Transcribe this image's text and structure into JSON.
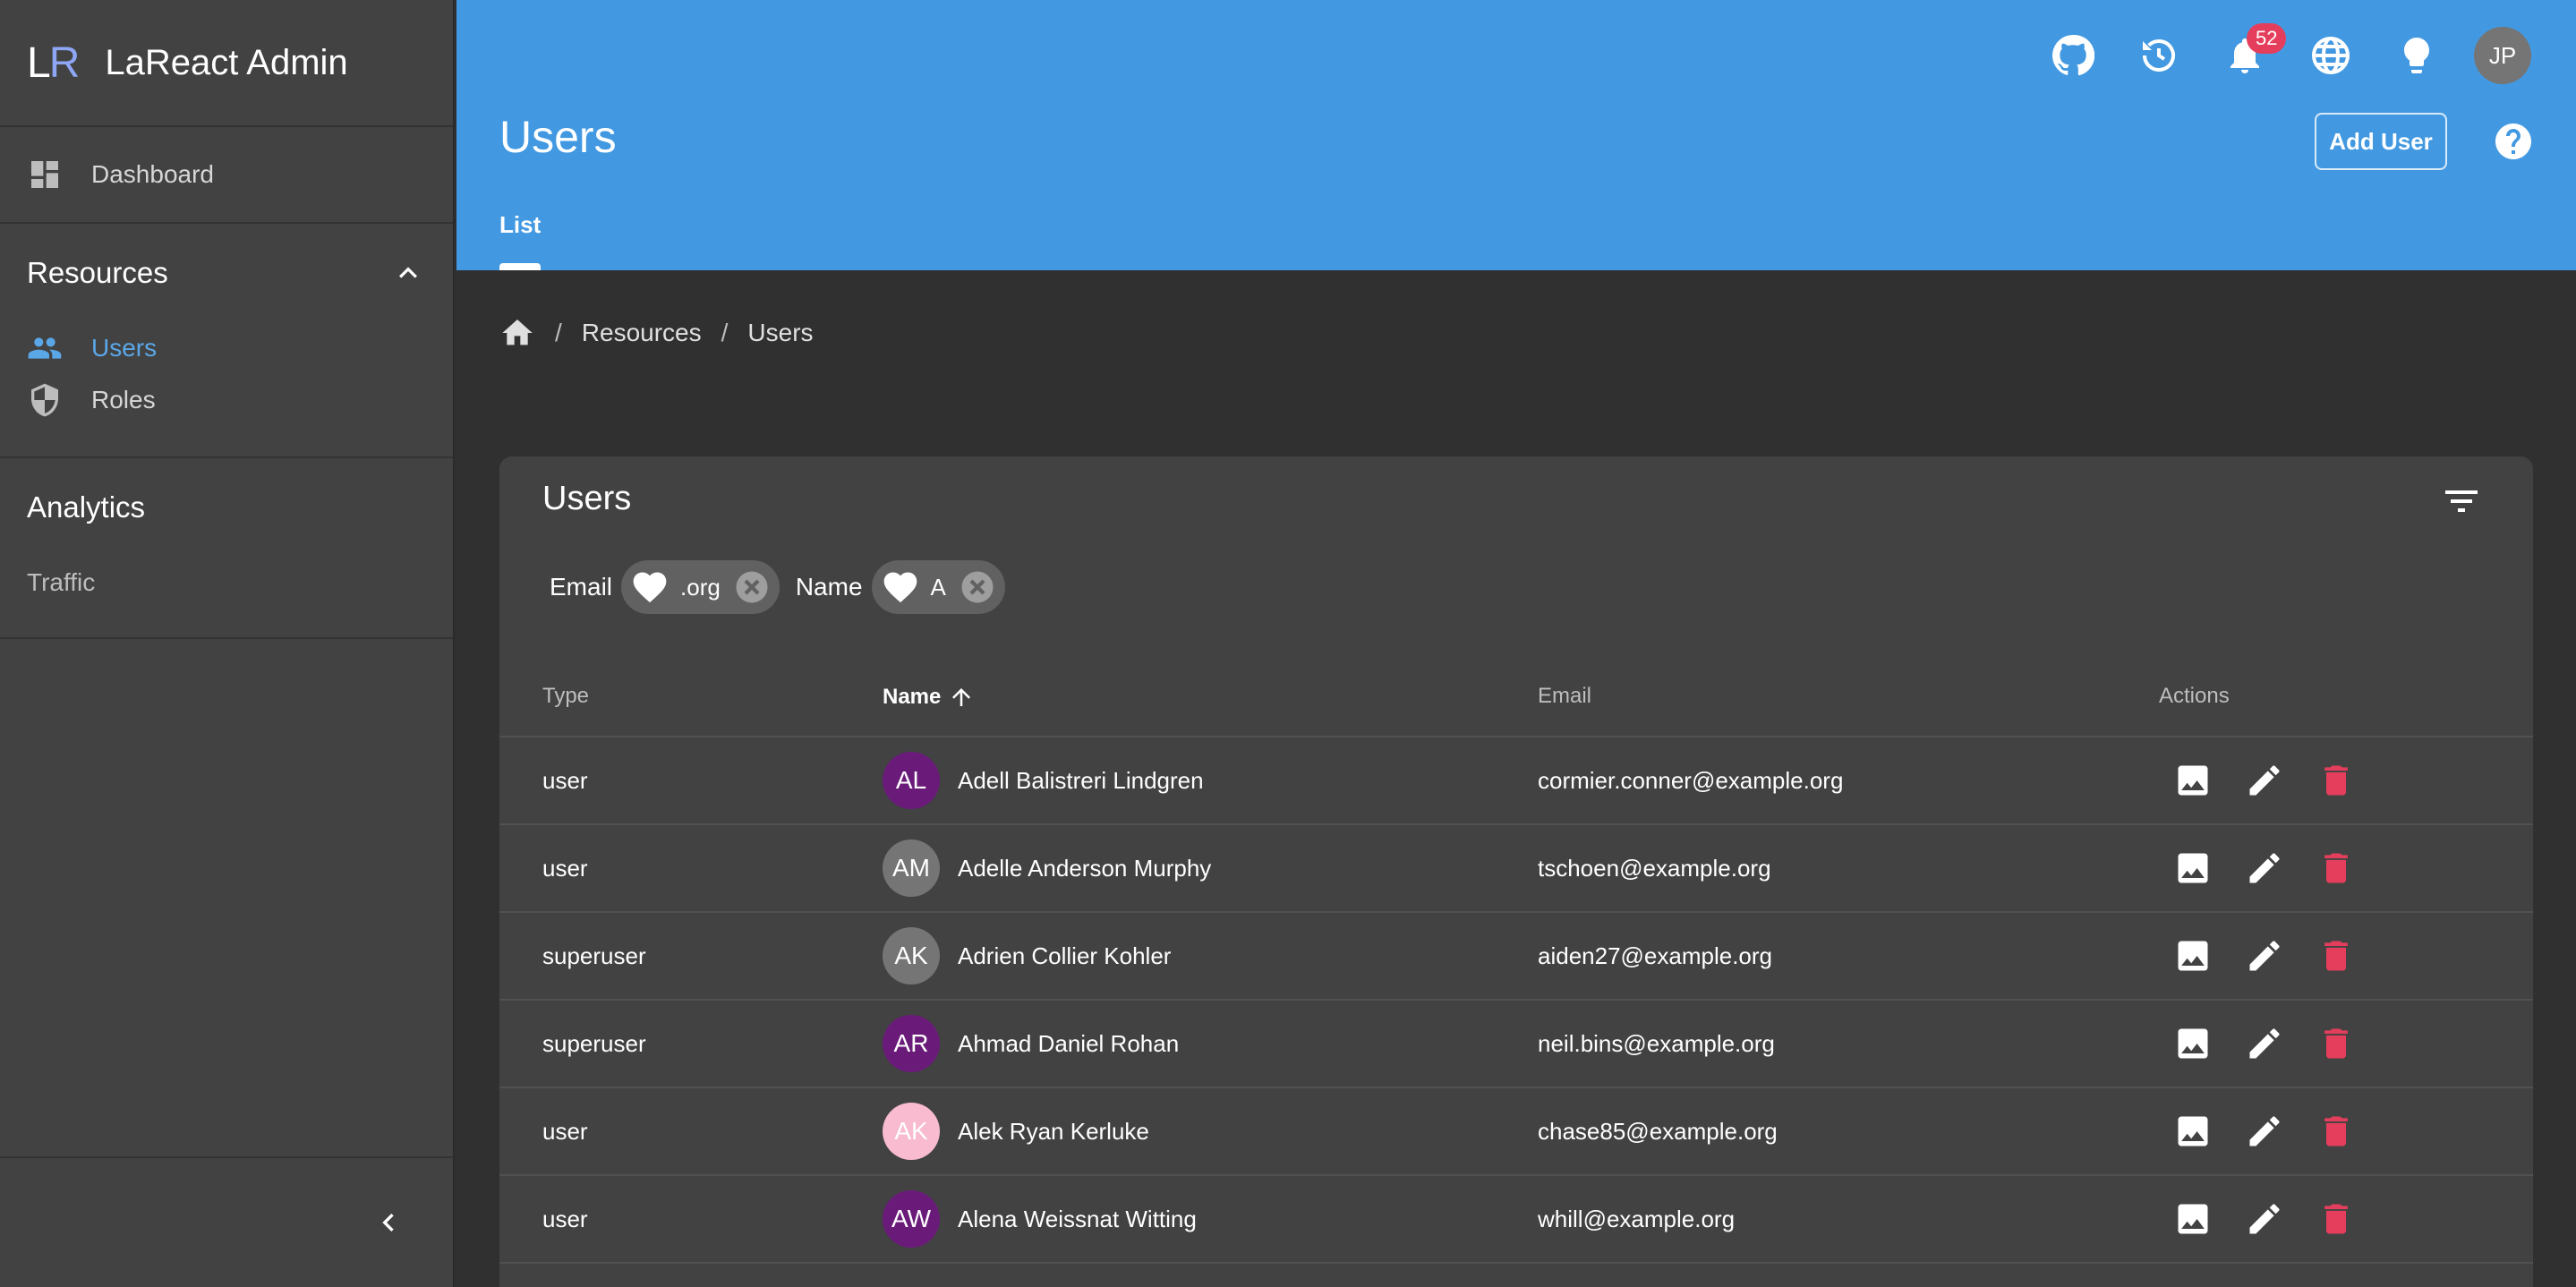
{
  "brand": {
    "logo_l": "L",
    "logo_r": "R",
    "title": "LaReact Admin"
  },
  "sidebar": {
    "dashboard": "Dashboard",
    "resources": {
      "title": "Resources",
      "items": [
        "Users",
        "Roles"
      ]
    },
    "analytics": {
      "title": "Analytics",
      "items": [
        "Traffic"
      ]
    }
  },
  "header": {
    "notifications_count": "52",
    "avatar_initials": "JP",
    "page_title": "Users",
    "add_user_label": "Add User",
    "tab_label": "List",
    "accent": "#4299e1"
  },
  "breadcrumb": {
    "items": [
      "Resources",
      "Users"
    ]
  },
  "card": {
    "title": "Users",
    "filters": [
      {
        "label": "Email",
        "value": ".org"
      },
      {
        "label": "Name",
        "value": "A"
      }
    ],
    "columns": {
      "type": "Type",
      "name": "Name",
      "email": "Email",
      "actions": "Actions"
    },
    "rows": [
      {
        "type": "user",
        "initials": "AL",
        "avatar_color": "#6a1b7a",
        "name": "Adell Balistreri Lindgren",
        "email": "cormier.conner@example.org"
      },
      {
        "type": "user",
        "initials": "AM",
        "avatar_color": "#757575",
        "name": "Adelle Anderson Murphy",
        "email": "tschoen@example.org"
      },
      {
        "type": "superuser",
        "initials": "AK",
        "avatar_color": "#757575",
        "name": "Adrien Collier Kohler",
        "email": "aiden27@example.org"
      },
      {
        "type": "superuser",
        "initials": "AR",
        "avatar_color": "#6a1b7a",
        "name": "Ahmad Daniel Rohan",
        "email": "neil.bins@example.org"
      },
      {
        "type": "user",
        "initials": "AK",
        "avatar_color": "#f8bbd0",
        "name": "Alek Ryan Kerluke",
        "email": "chase85@example.org"
      },
      {
        "type": "user",
        "initials": "AW",
        "avatar_color": "#6a1b7a",
        "name": "Alena Weissnat Witting",
        "email": "whill@example.org"
      }
    ],
    "delete_color": "#e53e5c"
  }
}
